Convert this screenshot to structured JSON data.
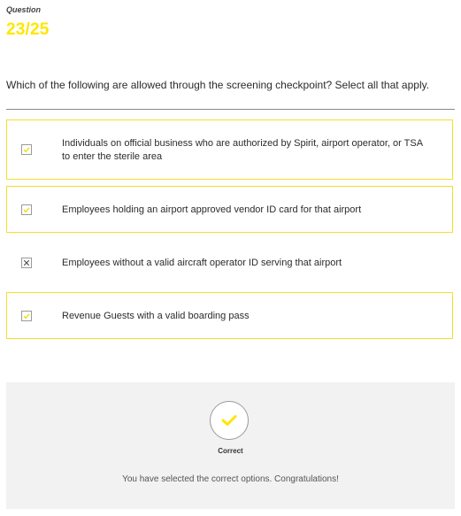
{
  "header": {
    "label": "Question",
    "counter": "23/25"
  },
  "question": {
    "text": "Which of the following are allowed through the screening checkpoint? Select all that apply."
  },
  "options": [
    {
      "text": "Individuals on official business who are authorized by Spirit, airport operator, or TSA to enter the sterile area",
      "selected": true,
      "mark": "check"
    },
    {
      "text": "Employees holding an airport approved vendor ID card for that airport",
      "selected": true,
      "mark": "check"
    },
    {
      "text": "Employees without a valid aircraft operator ID serving that airport",
      "selected": false,
      "mark": "x"
    },
    {
      "text": "Revenue Guests with a valid boarding pass",
      "selected": true,
      "mark": "check"
    }
  ],
  "result": {
    "title": "Correct",
    "message": "You have selected the correct options. Congratulations!",
    "icon": "checkmark-icon"
  },
  "colors": {
    "accent": "#ffe600",
    "selected_border": "#f3df2a",
    "result_bg": "#f2f2f2"
  }
}
